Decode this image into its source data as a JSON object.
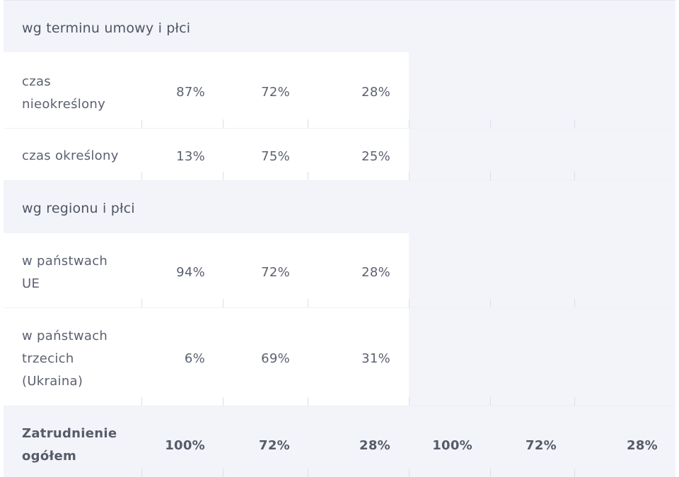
{
  "sections": {
    "contract": "wg terminu umowy i płci",
    "region": "wg regionu i płci"
  },
  "rows": {
    "indefinite": {
      "label": "czas nieokreślony",
      "c1": "87%",
      "c2": "72%",
      "c3": "28%"
    },
    "fixed": {
      "label": "czas określony",
      "c1": "13%",
      "c2": "75%",
      "c3": "25%"
    },
    "eu": {
      "label": "w państwach UE",
      "c1": "94%",
      "c2": "72%",
      "c3": "28%"
    },
    "third": {
      "label": "w państwach trzecich (Ukraina)",
      "c1": "6%",
      "c2": "69%",
      "c3": "31%"
    }
  },
  "total": {
    "label": "Zatrudnienie ogółem",
    "c1": "100%",
    "c2": "72%",
    "c3": "28%",
    "c4": "100%",
    "c5": "72%",
    "c6": "28%"
  },
  "colors": {
    "band_bg": "#f2f4f9",
    "text": "#5b6170"
  }
}
